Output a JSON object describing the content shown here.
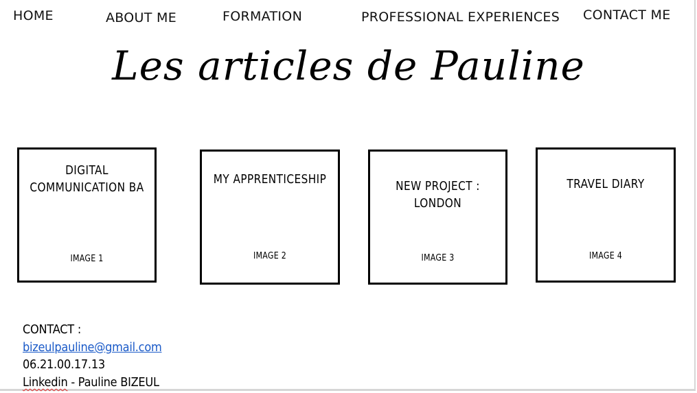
{
  "nav": {
    "home": "HOME",
    "about": "ABOUT ME",
    "formation": "FORMATION",
    "experiences": "PROFESSIONAL EXPERIENCES",
    "contact": "CONTACT ME"
  },
  "site_title": "Les articles de Pauline",
  "articles": [
    {
      "title": "DIGITAL\nCOMMUNICATION BA",
      "image": "IMAGE 1"
    },
    {
      "title": "MY APPRENTICESHIP",
      "image": "IMAGE 2"
    },
    {
      "title": "NEW PROJECT :\nLONDON",
      "image": "IMAGE 3"
    },
    {
      "title": "TRAVEL DIARY",
      "image": "IMAGE 4"
    }
  ],
  "contact": {
    "heading": "CONTACT  :",
    "email": "bizeulpauline@gmail.com",
    "phone": "06.21.00.17.13",
    "linkedin_label": "Linkedin",
    "linkedin_rest": " - Pauline BIZEUL"
  },
  "colors": {
    "link": "#1a5ac8",
    "border": "#000000"
  }
}
